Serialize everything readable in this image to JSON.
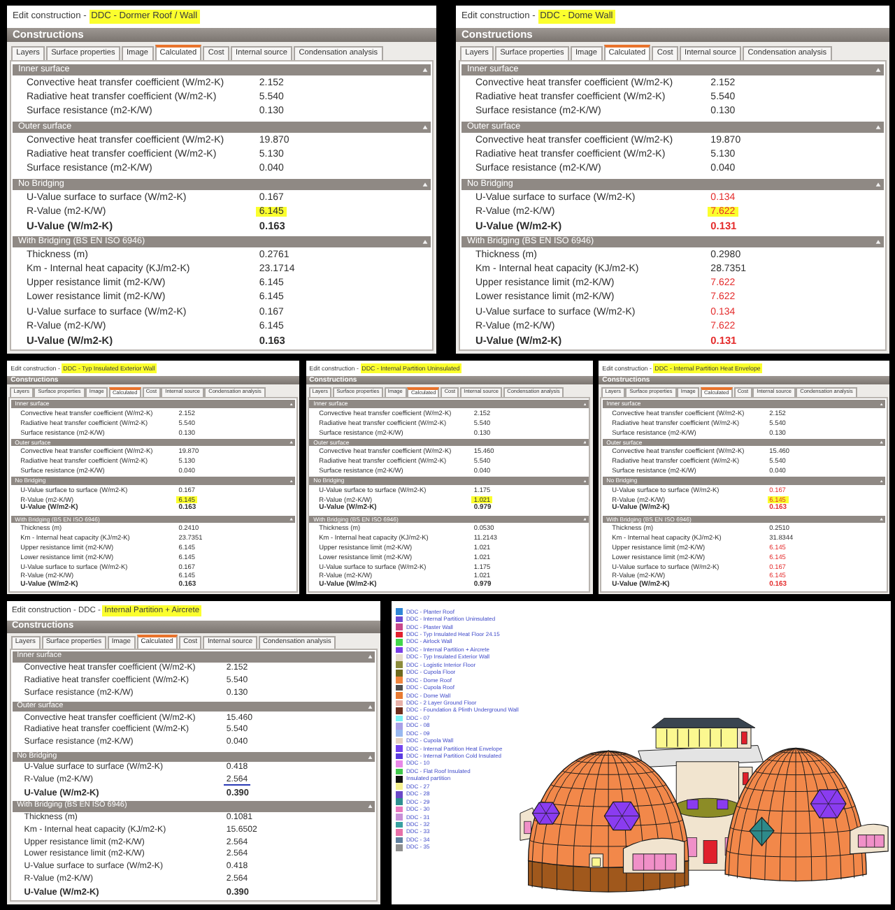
{
  "panels": [
    {
      "title": [
        {
          "text": "Edit construction - ",
          "highlighted": false
        },
        {
          "text": "DDC - Dormer Roof / Wall",
          "highlighted": true
        }
      ],
      "header": "Constructions",
      "tabs": [
        {
          "label": "Layers",
          "selected": false
        },
        {
          "label": "Surface properties",
          "selected": false
        },
        {
          "label": "Image",
          "selected": false
        },
        {
          "label": "Calculated",
          "selected": true
        },
        {
          "label": "Cost",
          "selected": false
        },
        {
          "label": "Internal source",
          "selected": false
        },
        {
          "label": "Condensation analysis",
          "selected": false
        }
      ],
      "sections": [
        {
          "title": "Inner surface",
          "rows": [
            {
              "label": "Convective heat transfer coefficient (W/m2-K)",
              "value": "2.152",
              "kind": "value",
              "warning": false,
              "highlighted": false,
              "underlined": false
            },
            {
              "label": "Radiative heat transfer coefficient (W/m2-K)",
              "value": "5.540",
              "kind": "value",
              "warning": false,
              "highlighted": false,
              "underlined": false
            },
            {
              "label": "Surface resistance (m2-K/W)",
              "value": "0.130",
              "kind": "value",
              "warning": false,
              "highlighted": false,
              "underlined": false
            }
          ]
        },
        {
          "title": "Outer surface",
          "rows": [
            {
              "label": "Convective heat transfer coefficient (W/m2-K)",
              "value": "19.870",
              "kind": "value",
              "warning": false,
              "highlighted": false,
              "underlined": false
            },
            {
              "label": "Radiative heat transfer coefficient (W/m2-K)",
              "value": "5.130",
              "kind": "value",
              "warning": false,
              "highlighted": false,
              "underlined": false
            },
            {
              "label": "Surface resistance (m2-K/W)",
              "value": "0.040",
              "kind": "value",
              "warning": false,
              "highlighted": false,
              "underlined": false
            }
          ]
        },
        {
          "title": "No Bridging",
          "rows": [
            {
              "label": "U-Value surface to surface (W/m2-K)",
              "value": "0.167",
              "kind": "value",
              "warning": false,
              "highlighted": false,
              "underlined": false
            },
            {
              "label": "R-Value (m2-K/W)",
              "value": "6.145",
              "kind": "value",
              "warning": false,
              "highlighted": true,
              "underlined": false
            },
            {
              "label": "U-Value (W/m2-K)",
              "value": "0.163",
              "kind": "total",
              "warning": false,
              "highlighted": false,
              "underlined": false
            }
          ]
        },
        {
          "title": "With Bridging (BS EN ISO 6946)",
          "rows": [
            {
              "label": "Thickness (m)",
              "value": "0.2761",
              "kind": "value",
              "warning": false,
              "highlighted": false,
              "underlined": false
            },
            {
              "label": "Km - Internal heat capacity (KJ/m2-K)",
              "value": "23.1714",
              "kind": "value",
              "warning": false,
              "highlighted": false,
              "underlined": false
            },
            {
              "label": "Upper resistance limit (m2-K/W)",
              "value": "6.145",
              "kind": "value",
              "warning": false,
              "highlighted": false,
              "underlined": false
            },
            {
              "label": "Lower resistance limit (m2-K/W)",
              "value": "6.145",
              "kind": "value",
              "warning": false,
              "highlighted": false,
              "underlined": false
            },
            {
              "label": "U-Value surface to surface (W/m2-K)",
              "value": "0.167",
              "kind": "value",
              "warning": false,
              "highlighted": false,
              "underlined": false
            },
            {
              "label": "R-Value (m2-K/W)",
              "value": "6.145",
              "kind": "value",
              "warning": false,
              "highlighted": false,
              "underlined": false
            },
            {
              "label": "U-Value (W/m2-K)",
              "value": "0.163",
              "kind": "total",
              "warning": false,
              "highlighted": false,
              "underlined": false
            }
          ]
        }
      ]
    },
    {
      "title": [
        {
          "text": "Edit construction - ",
          "highlighted": false
        },
        {
          "text": "DDC - Dome Wall",
          "highlighted": true
        }
      ],
      "header": "Constructions",
      "tabs": [
        {
          "label": "Layers",
          "selected": false
        },
        {
          "label": "Surface properties",
          "selected": false
        },
        {
          "label": "Image",
          "selected": false
        },
        {
          "label": "Calculated",
          "selected": true
        },
        {
          "label": "Cost",
          "selected": false
        },
        {
          "label": "Internal source",
          "selected": false
        },
        {
          "label": "Condensation analysis",
          "selected": false
        }
      ],
      "sections": [
        {
          "title": "Inner surface",
          "rows": [
            {
              "label": "Convective heat transfer coefficient (W/m2-K)",
              "value": "2.152",
              "kind": "value",
              "warning": false,
              "highlighted": false,
              "underlined": false
            },
            {
              "label": "Radiative heat transfer coefficient (W/m2-K)",
              "value": "5.540",
              "kind": "value",
              "warning": false,
              "highlighted": false,
              "underlined": false
            },
            {
              "label": "Surface resistance (m2-K/W)",
              "value": "0.130",
              "kind": "value",
              "warning": false,
              "highlighted": false,
              "underlined": false
            }
          ]
        },
        {
          "title": "Outer surface",
          "rows": [
            {
              "label": "Convective heat transfer coefficient (W/m2-K)",
              "value": "19.870",
              "kind": "value",
              "warning": false,
              "highlighted": false,
              "underlined": false
            },
            {
              "label": "Radiative heat transfer coefficient (W/m2-K)",
              "value": "5.130",
              "kind": "value",
              "warning": false,
              "highlighted": false,
              "underlined": false
            },
            {
              "label": "Surface resistance (m2-K/W)",
              "value": "0.040",
              "kind": "value",
              "warning": false,
              "highlighted": false,
              "underlined": false
            }
          ]
        },
        {
          "title": "No Bridging",
          "rows": [
            {
              "label": "U-Value surface to surface (W/m2-K)",
              "value": "0.134",
              "kind": "value",
              "warning": true,
              "highlighted": false,
              "underlined": false
            },
            {
              "label": "R-Value (m2-K/W)",
              "value": "7.622",
              "kind": "value",
              "warning": true,
              "highlighted": true,
              "underlined": false
            },
            {
              "label": "U-Value (W/m2-K)",
              "value": "0.131",
              "kind": "total",
              "warning": true,
              "highlighted": false,
              "underlined": false
            }
          ]
        },
        {
          "title": "With Bridging (BS EN ISO 6946)",
          "rows": [
            {
              "label": "Thickness (m)",
              "value": "0.2980",
              "kind": "value",
              "warning": false,
              "highlighted": false,
              "underlined": false
            },
            {
              "label": "Km - Internal heat capacity (KJ/m2-K)",
              "value": "28.7351",
              "kind": "value",
              "warning": false,
              "highlighted": false,
              "underlined": false
            },
            {
              "label": "Upper resistance limit (m2-K/W)",
              "value": "7.622",
              "kind": "value",
              "warning": true,
              "highlighted": false,
              "underlined": false
            },
            {
              "label": "Lower resistance limit (m2-K/W)",
              "value": "7.622",
              "kind": "value",
              "warning": true,
              "highlighted": false,
              "underlined": false
            },
            {
              "label": "U-Value surface to surface (W/m2-K)",
              "value": "0.134",
              "kind": "value",
              "warning": true,
              "highlighted": false,
              "underlined": false
            },
            {
              "label": "R-Value (m2-K/W)",
              "value": "7.622",
              "kind": "value",
              "warning": true,
              "highlighted": false,
              "underlined": false
            },
            {
              "label": "U-Value (W/m2-K)",
              "value": "0.131",
              "kind": "total",
              "warning": true,
              "highlighted": false,
              "underlined": false
            }
          ]
        }
      ]
    },
    {
      "title": [
        {
          "text": "Edit construction - ",
          "highlighted": false
        },
        {
          "text": "DDC - Typ Insulated Exterior Wall",
          "highlighted": true
        }
      ],
      "header": "Constructions",
      "tabs": [
        {
          "label": "Layers",
          "selected": false
        },
        {
          "label": "Surface properties",
          "selected": false
        },
        {
          "label": "Image",
          "selected": false
        },
        {
          "label": "Calculated",
          "selected": true
        },
        {
          "label": "Cost",
          "selected": false
        },
        {
          "label": "Internal source",
          "selected": false
        },
        {
          "label": "Condensation analysis",
          "selected": false
        }
      ],
      "sections": [
        {
          "title": "Inner surface",
          "rows": [
            {
              "label": "Convective heat transfer coefficient (W/m2-K)",
              "value": "2.152",
              "kind": "value",
              "warning": false,
              "highlighted": false,
              "underlined": false
            },
            {
              "label": "Radiative heat transfer coefficient (W/m2-K)",
              "value": "5.540",
              "kind": "value",
              "warning": false,
              "highlighted": false,
              "underlined": false
            },
            {
              "label": "Surface resistance (m2-K/W)",
              "value": "0.130",
              "kind": "value",
              "warning": false,
              "highlighted": false,
              "underlined": false
            }
          ]
        },
        {
          "title": "Outer surface",
          "rows": [
            {
              "label": "Convective heat transfer coefficient (W/m2-K)",
              "value": "19.870",
              "kind": "value",
              "warning": false,
              "highlighted": false,
              "underlined": false
            },
            {
              "label": "Radiative heat transfer coefficient (W/m2-K)",
              "value": "5.130",
              "kind": "value",
              "warning": false,
              "highlighted": false,
              "underlined": false
            },
            {
              "label": "Surface resistance (m2-K/W)",
              "value": "0.040",
              "kind": "value",
              "warning": false,
              "highlighted": false,
              "underlined": false
            }
          ]
        },
        {
          "title": "No Bridging",
          "rows": [
            {
              "label": "U-Value surface to surface (W/m2-K)",
              "value": "0.167",
              "kind": "value",
              "warning": false,
              "highlighted": false,
              "underlined": false
            },
            {
              "label": "R-Value (m2-K/W)",
              "value": "6.145",
              "kind": "value",
              "warning": false,
              "highlighted": true,
              "underlined": false
            },
            {
              "label": "U-Value (W/m2-K)",
              "value": "0.163",
              "kind": "total",
              "warning": false,
              "highlighted": false,
              "underlined": false
            }
          ]
        },
        {
          "title": "With Bridging (BS EN ISO 6946)",
          "rows": [
            {
              "label": "Thickness (m)",
              "value": "0.2410",
              "kind": "value",
              "warning": false,
              "highlighted": false,
              "underlined": false
            },
            {
              "label": "Km - Internal heat capacity (KJ/m2-K)",
              "value": "23.7351",
              "kind": "value",
              "warning": false,
              "highlighted": false,
              "underlined": false
            },
            {
              "label": "Upper resistance limit (m2-K/W)",
              "value": "6.145",
              "kind": "value",
              "warning": false,
              "highlighted": false,
              "underlined": false
            },
            {
              "label": "Lower resistance limit (m2-K/W)",
              "value": "6.145",
              "kind": "value",
              "warning": false,
              "highlighted": false,
              "underlined": false
            },
            {
              "label": "U-Value surface to surface (W/m2-K)",
              "value": "0.167",
              "kind": "value",
              "warning": false,
              "highlighted": false,
              "underlined": false
            },
            {
              "label": "R-Value (m2-K/W)",
              "value": "6.145",
              "kind": "value",
              "warning": false,
              "highlighted": false,
              "underlined": false
            },
            {
              "label": "U-Value (W/m2-K)",
              "value": "0.163",
              "kind": "total",
              "warning": false,
              "highlighted": false,
              "underlined": false
            }
          ]
        }
      ]
    },
    {
      "title": [
        {
          "text": "Edit construction - ",
          "highlighted": false
        },
        {
          "text": "DDC - Internal Partition Uninsulated",
          "highlighted": true
        }
      ],
      "header": "Constructions",
      "tabs": [
        {
          "label": "Layers",
          "selected": false
        },
        {
          "label": "Surface properties",
          "selected": false
        },
        {
          "label": "Image",
          "selected": false
        },
        {
          "label": "Calculated",
          "selected": true
        },
        {
          "label": "Cost",
          "selected": false
        },
        {
          "label": "Internal source",
          "selected": false
        },
        {
          "label": "Condensation analysis",
          "selected": false
        }
      ],
      "sections": [
        {
          "title": "Inner surface",
          "rows": [
            {
              "label": "Convective heat transfer coefficient (W/m2-K)",
              "value": "2.152",
              "kind": "value",
              "warning": false,
              "highlighted": false,
              "underlined": false
            },
            {
              "label": "Radiative heat transfer coefficient (W/m2-K)",
              "value": "5.540",
              "kind": "value",
              "warning": false,
              "highlighted": false,
              "underlined": false
            },
            {
              "label": "Surface resistance (m2-K/W)",
              "value": "0.130",
              "kind": "value",
              "warning": false,
              "highlighted": false,
              "underlined": false
            }
          ]
        },
        {
          "title": "Outer surface",
          "rows": [
            {
              "label": "Convective heat transfer coefficient (W/m2-K)",
              "value": "15.460",
              "kind": "value",
              "warning": false,
              "highlighted": false,
              "underlined": false
            },
            {
              "label": "Radiative heat transfer coefficient (W/m2-K)",
              "value": "5.540",
              "kind": "value",
              "warning": false,
              "highlighted": false,
              "underlined": false
            },
            {
              "label": "Surface resistance (m2-K/W)",
              "value": "0.040",
              "kind": "value",
              "warning": false,
              "highlighted": false,
              "underlined": false
            }
          ]
        },
        {
          "title": "No Bridging",
          "rows": [
            {
              "label": "U-Value surface to surface (W/m2-K)",
              "value": "1.175",
              "kind": "value",
              "warning": false,
              "highlighted": false,
              "underlined": false
            },
            {
              "label": "R-Value (m2-K/W)",
              "value": "1.021",
              "kind": "value",
              "warning": false,
              "highlighted": true,
              "underlined": false
            },
            {
              "label": "U-Value (W/m2-K)",
              "value": "0.979",
              "kind": "total",
              "warning": false,
              "highlighted": false,
              "underlined": false
            }
          ]
        },
        {
          "title": "With Bridging (BS EN ISO 6946)",
          "rows": [
            {
              "label": "Thickness (m)",
              "value": "0.0530",
              "kind": "value",
              "warning": false,
              "highlighted": false,
              "underlined": false
            },
            {
              "label": "Km - Internal heat capacity (KJ/m2-K)",
              "value": "11.2143",
              "kind": "value",
              "warning": false,
              "highlighted": false,
              "underlined": false
            },
            {
              "label": "Upper resistance limit (m2-K/W)",
              "value": "1.021",
              "kind": "value",
              "warning": false,
              "highlighted": false,
              "underlined": false
            },
            {
              "label": "Lower resistance limit (m2-K/W)",
              "value": "1.021",
              "kind": "value",
              "warning": false,
              "highlighted": false,
              "underlined": false
            },
            {
              "label": "U-Value surface to surface (W/m2-K)",
              "value": "1.175",
              "kind": "value",
              "warning": false,
              "highlighted": false,
              "underlined": false
            },
            {
              "label": "R-Value (m2-K/W)",
              "value": "1.021",
              "kind": "value",
              "warning": false,
              "highlighted": false,
              "underlined": false
            },
            {
              "label": "U-Value (W/m2-K)",
              "value": "0.979",
              "kind": "total",
              "warning": false,
              "highlighted": false,
              "underlined": false
            }
          ]
        }
      ]
    },
    {
      "title": [
        {
          "text": "Edit construction - ",
          "highlighted": false
        },
        {
          "text": "DDC - Internal Partition Heat Envelope",
          "highlighted": true
        }
      ],
      "header": "Constructions",
      "tabs": [
        {
          "label": "Layers",
          "selected": false
        },
        {
          "label": "Surface properties",
          "selected": false
        },
        {
          "label": "Image",
          "selected": false
        },
        {
          "label": "Calculated",
          "selected": true
        },
        {
          "label": "Cost",
          "selected": false
        },
        {
          "label": "Internal source",
          "selected": false
        },
        {
          "label": "Condensation analysis",
          "selected": false
        }
      ],
      "sections": [
        {
          "title": "Inner surface",
          "rows": [
            {
              "label": "Convective heat transfer coefficient (W/m2-K)",
              "value": "2.152",
              "kind": "value",
              "warning": false,
              "highlighted": false,
              "underlined": false
            },
            {
              "label": "Radiative heat transfer coefficient (W/m2-K)",
              "value": "5.540",
              "kind": "value",
              "warning": false,
              "highlighted": false,
              "underlined": false
            },
            {
              "label": "Surface resistance (m2-K/W)",
              "value": "0.130",
              "kind": "value",
              "warning": false,
              "highlighted": false,
              "underlined": false
            }
          ]
        },
        {
          "title": "Outer surface",
          "rows": [
            {
              "label": "Convective heat transfer coefficient (W/m2-K)",
              "value": "15.460",
              "kind": "value",
              "warning": false,
              "highlighted": false,
              "underlined": false
            },
            {
              "label": "Radiative heat transfer coefficient (W/m2-K)",
              "value": "5.540",
              "kind": "value",
              "warning": false,
              "highlighted": false,
              "underlined": false
            },
            {
              "label": "Surface resistance (m2-K/W)",
              "value": "0.040",
              "kind": "value",
              "warning": false,
              "highlighted": false,
              "underlined": false
            }
          ]
        },
        {
          "title": "No Bridging",
          "rows": [
            {
              "label": "U-Value surface to surface (W/m2-K)",
              "value": "0.167",
              "kind": "value",
              "warning": true,
              "highlighted": false,
              "underlined": false
            },
            {
              "label": "R-Value (m2-K/W)",
              "value": "6.145",
              "kind": "value",
              "warning": true,
              "highlighted": true,
              "underlined": false
            },
            {
              "label": "U-Value (W/m2-K)",
              "value": "0.163",
              "kind": "total",
              "warning": true,
              "highlighted": false,
              "underlined": false
            }
          ]
        },
        {
          "title": "With Bridging (BS EN ISO 6946)",
          "rows": [
            {
              "label": "Thickness (m)",
              "value": "0.2510",
              "kind": "value",
              "warning": false,
              "highlighted": false,
              "underlined": false
            },
            {
              "label": "Km - Internal heat capacity (KJ/m2-K)",
              "value": "31.8344",
              "kind": "value",
              "warning": false,
              "highlighted": false,
              "underlined": false
            },
            {
              "label": "Upper resistance limit (m2-K/W)",
              "value": "6.145",
              "kind": "value",
              "warning": true,
              "highlighted": false,
              "underlined": false
            },
            {
              "label": "Lower resistance limit (m2-K/W)",
              "value": "6.145",
              "kind": "value",
              "warning": true,
              "highlighted": false,
              "underlined": false
            },
            {
              "label": "U-Value surface to surface (W/m2-K)",
              "value": "0.167",
              "kind": "value",
              "warning": true,
              "highlighted": false,
              "underlined": false
            },
            {
              "label": "R-Value (m2-K/W)",
              "value": "6.145",
              "kind": "value",
              "warning": true,
              "highlighted": false,
              "underlined": false
            },
            {
              "label": "U-Value (W/m2-K)",
              "value": "0.163",
              "kind": "total",
              "warning": true,
              "highlighted": false,
              "underlined": false
            }
          ]
        }
      ]
    },
    {
      "title": [
        {
          "text": "Edit construction - DDC - ",
          "highlighted": false
        },
        {
          "text": "Internal Partition + Aircrete",
          "highlighted": true
        }
      ],
      "header": "Constructions",
      "tabs": [
        {
          "label": "Layers",
          "selected": false
        },
        {
          "label": "Surface properties",
          "selected": false
        },
        {
          "label": "Image",
          "selected": false
        },
        {
          "label": "Calculated",
          "selected": true
        },
        {
          "label": "Cost",
          "selected": false
        },
        {
          "label": "Internal source",
          "selected": false
        },
        {
          "label": "Condensation analysis",
          "selected": false
        }
      ],
      "sections": [
        {
          "title": "Inner surface",
          "rows": [
            {
              "label": "Convective heat transfer coefficient (W/m2-K)",
              "value": "2.152",
              "kind": "value",
              "warning": false,
              "highlighted": false,
              "underlined": false
            },
            {
              "label": "Radiative heat transfer coefficient (W/m2-K)",
              "value": "5.540",
              "kind": "value",
              "warning": false,
              "highlighted": false,
              "underlined": false
            },
            {
              "label": "Surface resistance (m2-K/W)",
              "value": "0.130",
              "kind": "value",
              "warning": false,
              "highlighted": false,
              "underlined": false
            }
          ]
        },
        {
          "title": "Outer surface",
          "rows": [
            {
              "label": "Convective heat transfer coefficient (W/m2-K)",
              "value": "15.460",
              "kind": "value",
              "warning": false,
              "highlighted": false,
              "underlined": false
            },
            {
              "label": "Radiative heat transfer coefficient (W/m2-K)",
              "value": "5.540",
              "kind": "value",
              "warning": false,
              "highlighted": false,
              "underlined": false
            },
            {
              "label": "Surface resistance (m2-K/W)",
              "value": "0.040",
              "kind": "value",
              "warning": false,
              "highlighted": false,
              "underlined": false
            }
          ]
        },
        {
          "title": "No Bridging",
          "rows": [
            {
              "label": "U-Value surface to surface (W/m2-K)",
              "value": "0.418",
              "kind": "value",
              "warning": false,
              "highlighted": false,
              "underlined": false
            },
            {
              "label": "R-Value (m2-K/W)",
              "value": "2.564",
              "kind": "value",
              "warning": false,
              "highlighted": false,
              "underlined": true
            },
            {
              "label": "U-Value (W/m2-K)",
              "value": "0.390",
              "kind": "total",
              "warning": false,
              "highlighted": false,
              "underlined": false
            }
          ]
        },
        {
          "title": "With Bridging (BS EN ISO 6946)",
          "rows": [
            {
              "label": "Thickness (m)",
              "value": "0.1081",
              "kind": "value",
              "warning": false,
              "highlighted": false,
              "underlined": false
            },
            {
              "label": "Km - Internal heat capacity (KJ/m2-K)",
              "value": "15.6502",
              "kind": "value",
              "warning": false,
              "highlighted": false,
              "underlined": false
            },
            {
              "label": "Upper resistance limit (m2-K/W)",
              "value": "2.564",
              "kind": "value",
              "warning": false,
              "highlighted": false,
              "underlined": false
            },
            {
              "label": "Lower resistance limit (m2-K/W)",
              "value": "2.564",
              "kind": "value",
              "warning": false,
              "highlighted": false,
              "underlined": false
            },
            {
              "label": "U-Value surface to surface (W/m2-K)",
              "value": "0.418",
              "kind": "value",
              "warning": false,
              "highlighted": false,
              "underlined": false
            },
            {
              "label": "R-Value (m2-K/W)",
              "value": "2.564",
              "kind": "value",
              "warning": false,
              "highlighted": false,
              "underlined": false
            },
            {
              "label": "U-Value (W/m2-K)",
              "value": "0.390",
              "kind": "total",
              "warning": false,
              "highlighted": false,
              "underlined": false
            }
          ]
        }
      ]
    }
  ],
  "model_view": {
    "legend": [
      {
        "label": "DDC - Planter Roof",
        "color": "#2f86d6"
      },
      {
        "label": "DDC - Internal Partition Uninsulated",
        "color": "#6c4ad4"
      },
      {
        "label": "DDC - Plaster Wall",
        "color": "#c8488c"
      },
      {
        "label": "DDC - Typ Insulated Heat Floor 24.15",
        "color": "#e2202e"
      },
      {
        "label": "DDC - Airlock Wall",
        "color": "#42d84a"
      },
      {
        "label": "DDC - Internal Partition + Aircrete",
        "color": "#7a3ee6"
      },
      {
        "label": "DDC - Typ Insulated Exterior Wall",
        "color": "#e6dccb"
      },
      {
        "label": "DDC - Logistic Interior Floor",
        "color": "#8c8c3c"
      },
      {
        "label": "DDC - Cupola Floor",
        "color": "#6e6a1e"
      },
      {
        "label": "DDC - Dome Roof",
        "color": "#f0853e"
      },
      {
        "label": "DDC - Cupola Roof",
        "color": "#4e4e4e"
      },
      {
        "label": "DDC - Dome Wall",
        "color": "#e87a32"
      },
      {
        "label": "DDC - 2 Layer Ground Floor",
        "color": "#e8b0a8"
      },
      {
        "label": "DDC - Foundation & Plinth Underground Wall",
        "color": "#6e2e1e"
      },
      {
        "label": "DDC - 07",
        "color": "#78f0f4"
      },
      {
        "label": "DDC - 08",
        "color": "#a8a0e8"
      },
      {
        "label": "DDC - 09",
        "color": "#98b8f0"
      },
      {
        "label": "DDC - Cupola Wall",
        "color": "#e6d2c2"
      },
      {
        "label": "DDC - Internal Partition Heat Envelope",
        "color": "#7444f0"
      },
      {
        "label": "DDC - Internal Partition Cold Insulated",
        "color": "#5a3ce0"
      },
      {
        "label": "DDC - 10",
        "color": "#e888e8"
      },
      {
        "label": "DDC - Flat Roof Insulated",
        "color": "#40c84a"
      },
      {
        "label": "Insulated partition",
        "color": "#101010"
      },
      {
        "label": "DDC - 27",
        "color": "#f4f08c"
      },
      {
        "label": "DDC - 28",
        "color": "#6a48c8"
      },
      {
        "label": "DDC - 29",
        "color": "#2e9090"
      },
      {
        "label": "DDC - 30",
        "color": "#e878c0"
      },
      {
        "label": "DDC - 31",
        "color": "#c890d8"
      },
      {
        "label": "DDC - 32",
        "color": "#38a0a0"
      },
      {
        "label": "DDC - 33",
        "color": "#e870a8"
      },
      {
        "label": "DDC - 34",
        "color": "#6080a0"
      },
      {
        "label": "DDC - 35",
        "color": "#909090"
      }
    ]
  }
}
